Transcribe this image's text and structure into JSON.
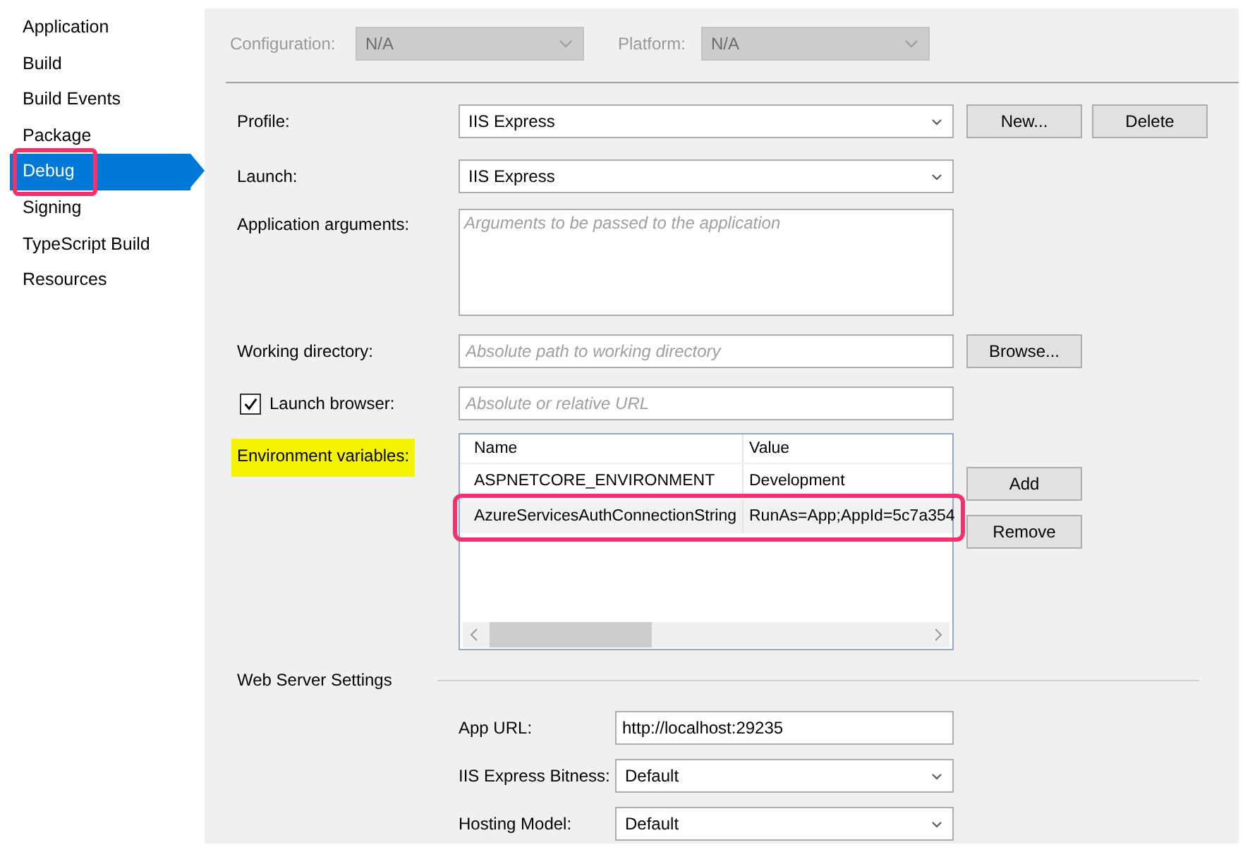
{
  "sidebar": {
    "items": [
      {
        "label": "Application",
        "selected": false,
        "highlighted": false
      },
      {
        "label": "Build",
        "selected": false,
        "highlighted": false
      },
      {
        "label": "Build Events",
        "selected": false,
        "highlighted": false
      },
      {
        "label": "Package",
        "selected": false,
        "highlighted": false
      },
      {
        "label": "Debug",
        "selected": true,
        "highlighted": true
      },
      {
        "label": "Signing",
        "selected": false,
        "highlighted": false
      },
      {
        "label": "TypeScript Build",
        "selected": false,
        "highlighted": false
      },
      {
        "label": "Resources",
        "selected": false,
        "highlighted": false
      }
    ]
  },
  "config_bar": {
    "configuration": {
      "label": "Configuration:",
      "value": "N/A",
      "disabled": true
    },
    "platform": {
      "label": "Platform:",
      "value": "N/A",
      "disabled": true
    }
  },
  "profile": {
    "label": "Profile:",
    "value": "IIS Express",
    "buttons": [
      "New...",
      "Delete"
    ]
  },
  "launch": {
    "label": "Launch:",
    "value": "IIS Express"
  },
  "application_arguments": {
    "label": "Application arguments:",
    "placeholder": "Arguments to be passed to the application"
  },
  "working_directory": {
    "label": "Working directory:",
    "placeholder": "Absolute path to working directory",
    "button": "Browse..."
  },
  "launch_browser": {
    "label": "Launch browser:",
    "checked": true,
    "placeholder": "Absolute or relative URL"
  },
  "environment_variables": {
    "label": "Environment variables:",
    "highlighted": true,
    "columns": [
      "Name",
      "Value"
    ],
    "rows": [
      {
        "name": "ASPNETCORE_ENVIRONMENT",
        "value": "Development",
        "selected": false,
        "highlighted": false
      },
      {
        "name": "AzureServicesAuthConnectionString",
        "value": "RunAs=App;AppId=5c7a354",
        "selected": true,
        "highlighted": true
      }
    ],
    "buttons": [
      "Add",
      "Remove"
    ]
  },
  "web_server_settings": {
    "title": "Web Server Settings",
    "app_url": {
      "label": "App URL:",
      "value": "http://localhost:29235"
    },
    "iis_express_bitness": {
      "label": "IIS Express Bitness:",
      "value": "Default"
    },
    "hosting_model": {
      "label": "Hosting Model:",
      "value": "Default"
    }
  }
}
